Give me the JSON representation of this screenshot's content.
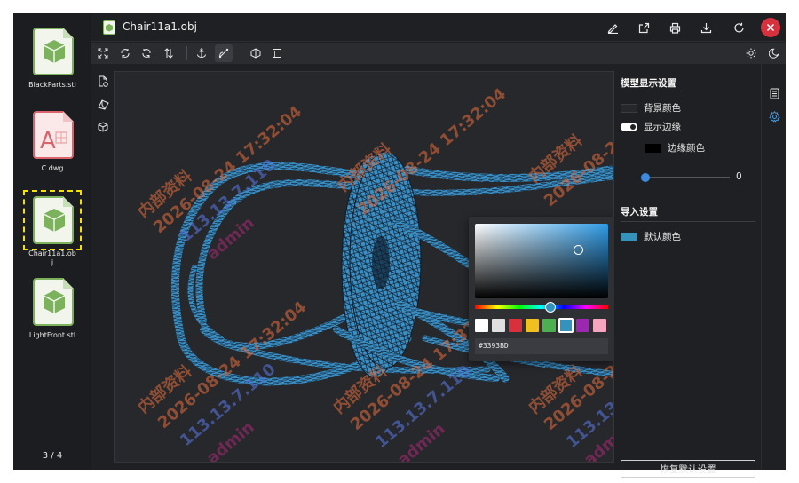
{
  "app": {
    "title": "Chair11a1.obj"
  },
  "thumbnails": [
    {
      "label": "BlackParts.stl",
      "type": "3d-model-file",
      "selected": false
    },
    {
      "label": "C.dwg",
      "type": "cad-drawing-file",
      "selected": false
    },
    {
      "label": "Chair11a1.obj",
      "type": "3d-model-file",
      "selected": true
    },
    {
      "label": "LightFront.stl",
      "type": "3d-model-file",
      "selected": false
    }
  ],
  "page_counter": "3 / 4",
  "titlebar_actions": [
    "edit-icon",
    "open-external-icon",
    "print-icon",
    "download-icon",
    "refresh-icon",
    "close-icon"
  ],
  "toolbar_tools": [
    "fit-view-icon",
    "rotate-x-icon",
    "rotate-y-icon",
    "flip-icon",
    "anchor-icon",
    "measure-icon",
    "shading-icon",
    "wireframe-icon",
    "light-icon",
    "dark-mode-icon"
  ],
  "side_tools": [
    "file-info-icon",
    "section-icon",
    "cube-icon"
  ],
  "watermark": {
    "line1": "内部资料",
    "line2": "2026-08-24 17:32:04",
    "line3": "113.13.7.110",
    "line4": "admin"
  },
  "color_picker": {
    "hex_value": "#3393BD",
    "swatches": [
      "#ffffff",
      "#e0e0e0",
      "#d9303e",
      "#f0c020",
      "#4caf50",
      "#3393bd",
      "#9c27b0",
      "#f4a6c0"
    ]
  },
  "settings": {
    "display_section_title": "模型显示设置",
    "background_color_label": "背景颜色",
    "show_edges_label": "显示边缘",
    "show_edges_on": true,
    "edge_color_label": "边缘颜色",
    "edge_width_value": "0",
    "import_section_title": "导入设置",
    "default_color_label": "默认颜色",
    "default_color": "#3393bd",
    "reset_label": "恢复默认设置"
  },
  "colors": {
    "model_fill": "#3b8fc4",
    "selection_outline": "#f5e000",
    "close_button": "#d6313d"
  }
}
